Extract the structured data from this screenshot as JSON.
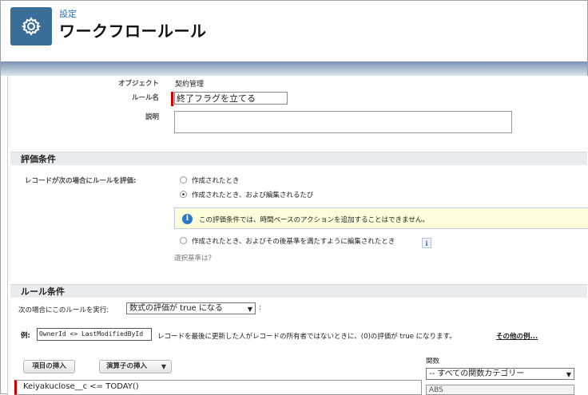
{
  "header": {
    "breadcrumb": "設定",
    "title": "ワークフロールール",
    "icon": "gear-icon",
    "icon_bg_color": "#3a6e99"
  },
  "details": {
    "object_label": "オブジェクト",
    "object_value": "契約管理",
    "rule_name_label": "ルール名",
    "rule_name_value": "終了フラグを立てる",
    "description_label": "説明",
    "description_value": ""
  },
  "evaluation": {
    "section_title": "評価条件",
    "prompt": "レコードが次の場合にルールを評価:",
    "options": [
      {
        "label": "作成されたとき",
        "selected": false
      },
      {
        "label": "作成されたとき、および編集されるたび",
        "selected": true
      },
      {
        "label": "作成されたとき、およびその後基準を満たすように編集されたとき",
        "selected": false
      }
    ],
    "info_text": "この評価条件では、時間ベースのアクションを追加することはできません。",
    "help_button": "i",
    "criteria_link": "選択基準は？"
  },
  "rule_criteria": {
    "section_title": "ルール条件",
    "run_label": "次の場合にこのルールを実行:",
    "run_select": "数式の評価が true になる",
    "colon": ":",
    "example_label": "例:",
    "example_formula": "OwnerId <> LastModifiedById",
    "example_text": "レコードを最後に更新した人がレコードの所有者ではないときに、(0)の評価が true になります。",
    "more_examples_link": "その他の例...",
    "insert_field_button": "項目の挿入",
    "insert_operator_button": "演算子の挿入",
    "formula_value": "Keiyakuclose__c   <=   TODAY()",
    "functions_label": "関数",
    "functions_select": "-- すべての関数カテゴリー",
    "functions_list_first": "ABS"
  },
  "colors": {
    "required": "#cc0000",
    "link": "#2b6fb0",
    "info_bg": "#ffffdc",
    "section_bg": "#e9ecef"
  }
}
